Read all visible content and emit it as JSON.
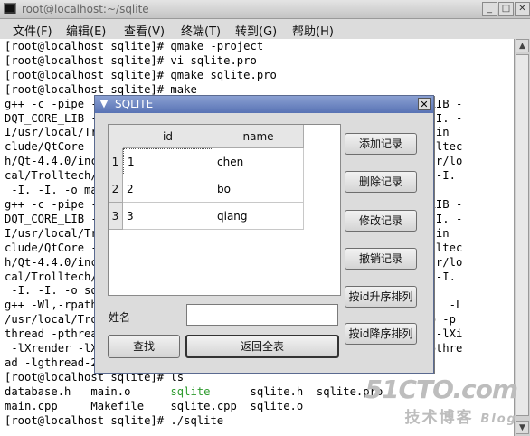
{
  "window": {
    "title": "root@localhost:~/sqlite",
    "controls": [
      "_",
      "□",
      "✕"
    ]
  },
  "menu": [
    {
      "label": "文件(F)"
    },
    {
      "label": "编辑(E)"
    },
    {
      "label": "查看(V)"
    },
    {
      "label": "终端(T)"
    },
    {
      "label": "转到(G)"
    },
    {
      "label": "帮助(H)"
    }
  ],
  "terminal": {
    "lines": [
      "[root@localhost sqlite]# qmake -project",
      "[root@localhost sqlite]# vi sqlite.pro",
      "[root@localhost sqlite]# qmake sqlite.pro",
      "[root@localhost sqlite]# make",
      "g++ -c -pipe -                                           QT_GUI_LIB -",
      "DQT_CORE_LIB -                                          nux-g++ -I. -",
      "I/usr/local/Tr                                         /Qt-4.4.0/in",
      "clude/QtCore -                                          ocal/Trolltec",
      "h/Qt-4.4.0/inc                                          Sql -I/usr/lo",
      "cal/Trolltech/                                         0/include -I.",
      " -I. -I. -o ma",
      "g++ -c -pipe -                                           QT_GUI_LIB -",
      "DQT_CORE_LIB -                                          nux-g++ -I. -",
      "I/usr/local/Tr                                         /Qt-4.4.0/in",
      "clude/QtCore -                                          ocal/Trolltec",
      "h/Qt-4.4.0/inc                                          Sql -I/usr/lo",
      "cal/Trolltech/                                         0/include -I.",
      " -I. -I. -o sq",
      "g++ -Wl,-rpath                                          qlite.o    -L",
      "/usr/local/Tro                                          4.4.0/lib -p",
      "thread -pthrea                                          -pthread -lXi",
      " -lXrender -lX                                          lz -lm -pthre",
      "ad -lgthread-2",
      "[root@localhost sqlite]# ls"
    ],
    "ls_row1": [
      "database.h",
      "main.o",
      "sqlite",
      "sqlite.h",
      "sqlite.pro"
    ],
    "ls_row2": [
      "main.cpp",
      "Makefile",
      "sqlite.cpp",
      "sqlite.o"
    ],
    "last_line": "[root@localhost sqlite]# ./sqlite"
  },
  "dialog": {
    "title": "SQLITE",
    "table": {
      "headers": [
        "id",
        "name"
      ],
      "rows": [
        {
          "num": "1",
          "id": "1",
          "name": "chen"
        },
        {
          "num": "2",
          "id": "2",
          "name": "bo"
        },
        {
          "num": "3",
          "id": "3",
          "name": "qiang"
        }
      ]
    },
    "name_label": "姓名",
    "name_value": "",
    "buttons": {
      "add": "添加记录",
      "delete": "删除记录",
      "edit": "修改记录",
      "undo": "撤销记录",
      "sort_asc": "按id升序排列",
      "sort_desc": "按id降序排列",
      "search": "查找",
      "show_all": "返回全表"
    }
  },
  "watermark": {
    "line1": "51CTO.com",
    "line2": "技术博客",
    "line3": "Blog"
  }
}
